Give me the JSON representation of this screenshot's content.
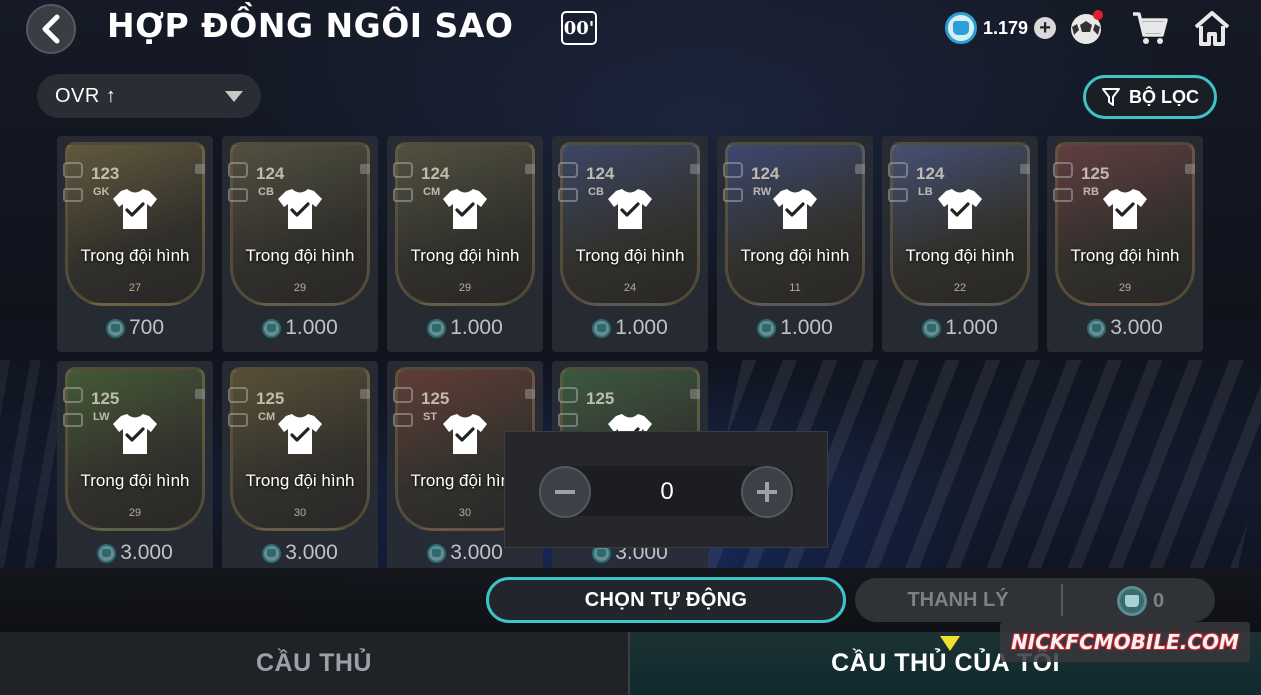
{
  "header": {
    "title": "HỢP ĐỒNG NGÔI SAO",
    "badge": "00'",
    "currency_amount": "1.179"
  },
  "sort": {
    "label": "OVR ↑"
  },
  "filter": {
    "label": "BỘ LỌC"
  },
  "status_label": "Trong đội hình",
  "cards": [
    {
      "rating": "123",
      "position": "GK",
      "number": "27",
      "price": "700",
      "color": "#8a7a45"
    },
    {
      "rating": "124",
      "position": "CB",
      "number": "29",
      "price": "1.000",
      "color": "#6f6a4a"
    },
    {
      "rating": "124",
      "position": "CM",
      "number": "29",
      "price": "1.000",
      "color": "#6f6a4a"
    },
    {
      "rating": "124",
      "position": "CB",
      "number": "24",
      "price": "1.000",
      "color": "#4a5a8a"
    },
    {
      "rating": "124",
      "position": "RW",
      "number": "11",
      "price": "1.000",
      "color": "#4a5c9a"
    },
    {
      "rating": "124",
      "position": "LB",
      "number": "22",
      "price": "1.000",
      "color": "#5a6aa0"
    },
    {
      "rating": "125",
      "position": "RB",
      "number": "29",
      "price": "3.000",
      "color": "#8a4a4a"
    },
    {
      "rating": "125",
      "position": "LW",
      "number": "29",
      "price": "3.000",
      "color": "#5a7a3a"
    },
    {
      "rating": "125",
      "position": "CM",
      "number": "30",
      "price": "3.000",
      "color": "#7a6a3a"
    },
    {
      "rating": "125",
      "position": "ST",
      "number": "30",
      "price": "3.000",
      "color": "#8a4a3a"
    },
    {
      "rating": "125",
      "position": "",
      "number": "",
      "price": "3.000",
      "color": "#4a7a4a"
    }
  ],
  "stepper": {
    "value": "0"
  },
  "actions": {
    "auto_select": "CHỌN TỰ ĐỘNG",
    "sell": "THANH LÝ",
    "sell_value": "0"
  },
  "tabs": {
    "players": "CẦU THỦ",
    "my_players": "CẦU THỦ CỦA TÔI"
  },
  "watermark": "NICKFCMOBILE.COM",
  "colors": {
    "accent": "#3fc4c6",
    "indicator": "#f0e030"
  }
}
